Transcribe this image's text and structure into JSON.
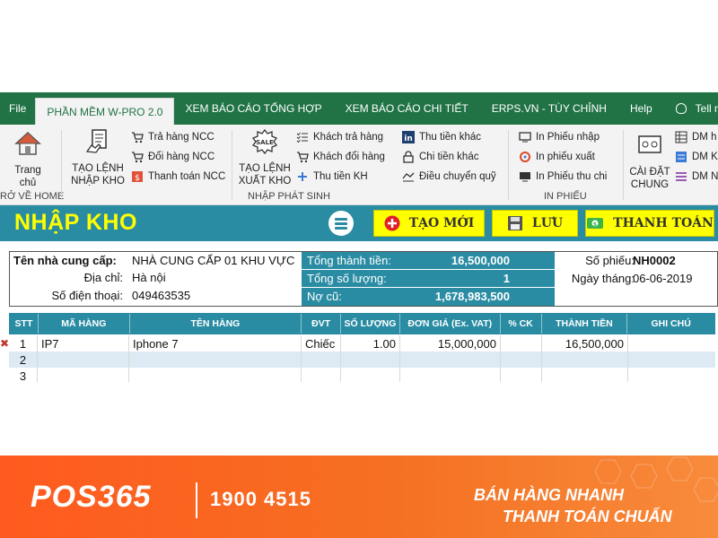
{
  "ribbon_tabs": [
    {
      "label": "File"
    },
    {
      "label": "PHẦN MỀM W-PRO 2.0"
    },
    {
      "label": "XEM BÁO CÁO TỔNG HỢP"
    },
    {
      "label": "XEM BÁO CÁO CHI TIẾT"
    },
    {
      "label": "ERPS.VN - TÙY CHỈNH"
    },
    {
      "label": "Help"
    },
    {
      "label": "Tell me wh"
    }
  ],
  "ribbon": {
    "home_label": "Trang chủ",
    "home_group": "RỞ VỀ HOME",
    "tao_lenh_nhap_1": "TẠO LỆNH",
    "tao_lenh_nhap_2": "NHẬP KHO",
    "tra_hang_ncc": "Trả hàng NCC",
    "doi_hang_ncc": "Đổi hàng NCC",
    "thanh_toan_ncc": "Thanh toán NCC",
    "tao_lenh_xuat_1": "TẠO LỆNH",
    "tao_lenh_xuat_2": "XUẤT KHO",
    "khach_tra_hang": "Khách trả hàng",
    "khach_doi_hang": "Khách đổi hàng",
    "thu_tien_kh": "Thu tiền KH",
    "thu_tien_khac": "Thu tiền khác",
    "chi_tien_khac": "Chi tiền khác",
    "dieu_chuyen_quy": "Điều chuyển quỹ",
    "nhap_phat_sinh": "NHẬP PHÁT SINH",
    "in_phieu_nhap": "In Phiếu nhập",
    "in_phieu_xuat": "In phiếu xuất",
    "in_phieu_thu_chi": "In Phiếu thu chi",
    "in_phieu_group": "IN PHIẾU",
    "cai_dat_1": "CÀI ĐẶT",
    "cai_dat_2": "CHUNG",
    "dm_1": "DM h",
    "dm_2": "DM K",
    "dm_3": "DM N"
  },
  "form": {
    "title": "NHẬP KHO",
    "btn_tao_moi": "TẠO MỚI",
    "btn_luu": "LƯU",
    "btn_thanh_toan": "THANH TOÁN"
  },
  "info": {
    "supplier_label": "Tên nhà cung cấp:",
    "supplier_value": "NHÀ CUNG CẤP 01 KHU VỰC",
    "address_label": "Địa chỉ:",
    "address_value": "Hà nội",
    "phone_label": "Số điện thoại:",
    "phone_value": "049463535",
    "total_amount_label": "Tổng thành tiền:",
    "total_amount_value": "16,500,000",
    "total_qty_label": "Tổng số lượng:",
    "total_qty_value": "1",
    "old_debt_label": "Nợ cũ:",
    "old_debt_value": "1,678,983,500",
    "voucher_label": "Số phiếu:",
    "voucher_value": "NH0002",
    "date_label": "Ngày tháng:",
    "date_value": "06-06-2019"
  },
  "grid": {
    "headers": [
      "STT",
      "MÃ HÀNG",
      "TÊN HÀNG",
      "ĐVT",
      "SỐ LƯỢNG",
      "ĐƠN GIÁ (Ex. VAT)",
      "% CK",
      "THÀNH TIỀN",
      "GHI CHÚ"
    ],
    "rows": [
      {
        "stt": "1",
        "ma": "IP7",
        "ten": "Iphone 7",
        "dvt": "Chiếc",
        "sl": "1.00",
        "dongia": "15,000,000",
        "ck": "",
        "thanhtien": "16,500,000",
        "ghichu": ""
      },
      {
        "stt": "2",
        "ma": "",
        "ten": "",
        "dvt": "",
        "sl": "",
        "dongia": "",
        "ck": "",
        "thanhtien": "",
        "ghichu": ""
      },
      {
        "stt": "3",
        "ma": "",
        "ten": "",
        "dvt": "",
        "sl": "",
        "dongia": "",
        "ck": "",
        "thanhtien": "",
        "ghichu": ""
      }
    ]
  },
  "banner": {
    "logo": "POS365",
    "hotline": "1900 4515",
    "slogan_1": "BÁN HÀNG NHANH",
    "slogan_2": "THANH TOÁN CHUẨN"
  },
  "colors": {
    "ribbon_green": "#217346",
    "teal": "#2a8ca3",
    "title_yellow": "#ffff00",
    "banner_orange": "#f57022"
  }
}
